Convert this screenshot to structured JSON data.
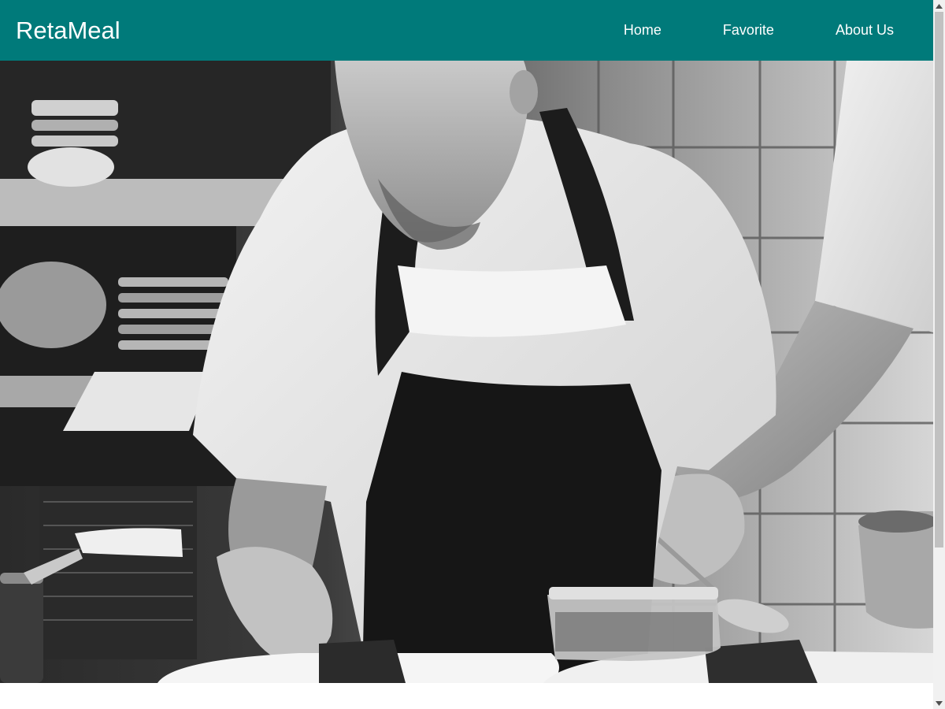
{
  "navbar": {
    "brand": "RetaMeal",
    "links": [
      "Home",
      "Favorite",
      "About Us"
    ],
    "background_color": "#007a7a"
  },
  "hero": {
    "image_description_icon": "chef-plating-photo",
    "style": "grayscale"
  }
}
